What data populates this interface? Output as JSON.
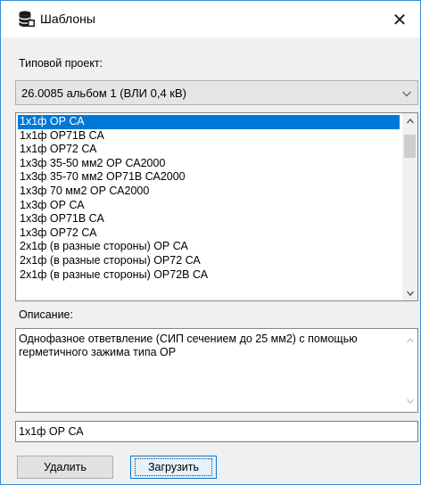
{
  "window": {
    "title": "Шаблоны",
    "app_icon": "database-icon",
    "close_glyph": "✕"
  },
  "project": {
    "label": "Типовой проект:",
    "selected": "26.0085 альбом 1 (ВЛИ 0,4 кВ)"
  },
  "templates": {
    "items": [
      "1х1ф ОР СА",
      "1х1ф ОР71В СА",
      "1х1ф ОР72 СА",
      "1х3ф 35-50 мм2 ОР СА2000",
      "1х3ф 35-70 мм2 ОР71В СА2000",
      "1х3ф 70 мм2 ОР СА2000",
      "1х3ф ОР СА",
      "1х3ф ОР71В СА",
      "1х3ф ОР72 СА",
      "2х1ф (в разные стороны) ОР СА",
      "2х1ф (в разные стороны) ОР72 СА",
      "2х1ф (в разные стороны) ОР72В СА"
    ],
    "selected_index": 0
  },
  "description": {
    "label": "Описание:",
    "text": "Однофазное ответвление (СИП сечением до 25 мм2) с помощью герметичного зажима типа ОР"
  },
  "name_field": {
    "value": "1х1ф ОР СА"
  },
  "buttons": {
    "delete": "Удалить",
    "load": "Загрузить"
  },
  "colors": {
    "selection": "#0078d7",
    "window_border": "#3a8bd8",
    "dialog_bg": "#f0f0f0"
  }
}
